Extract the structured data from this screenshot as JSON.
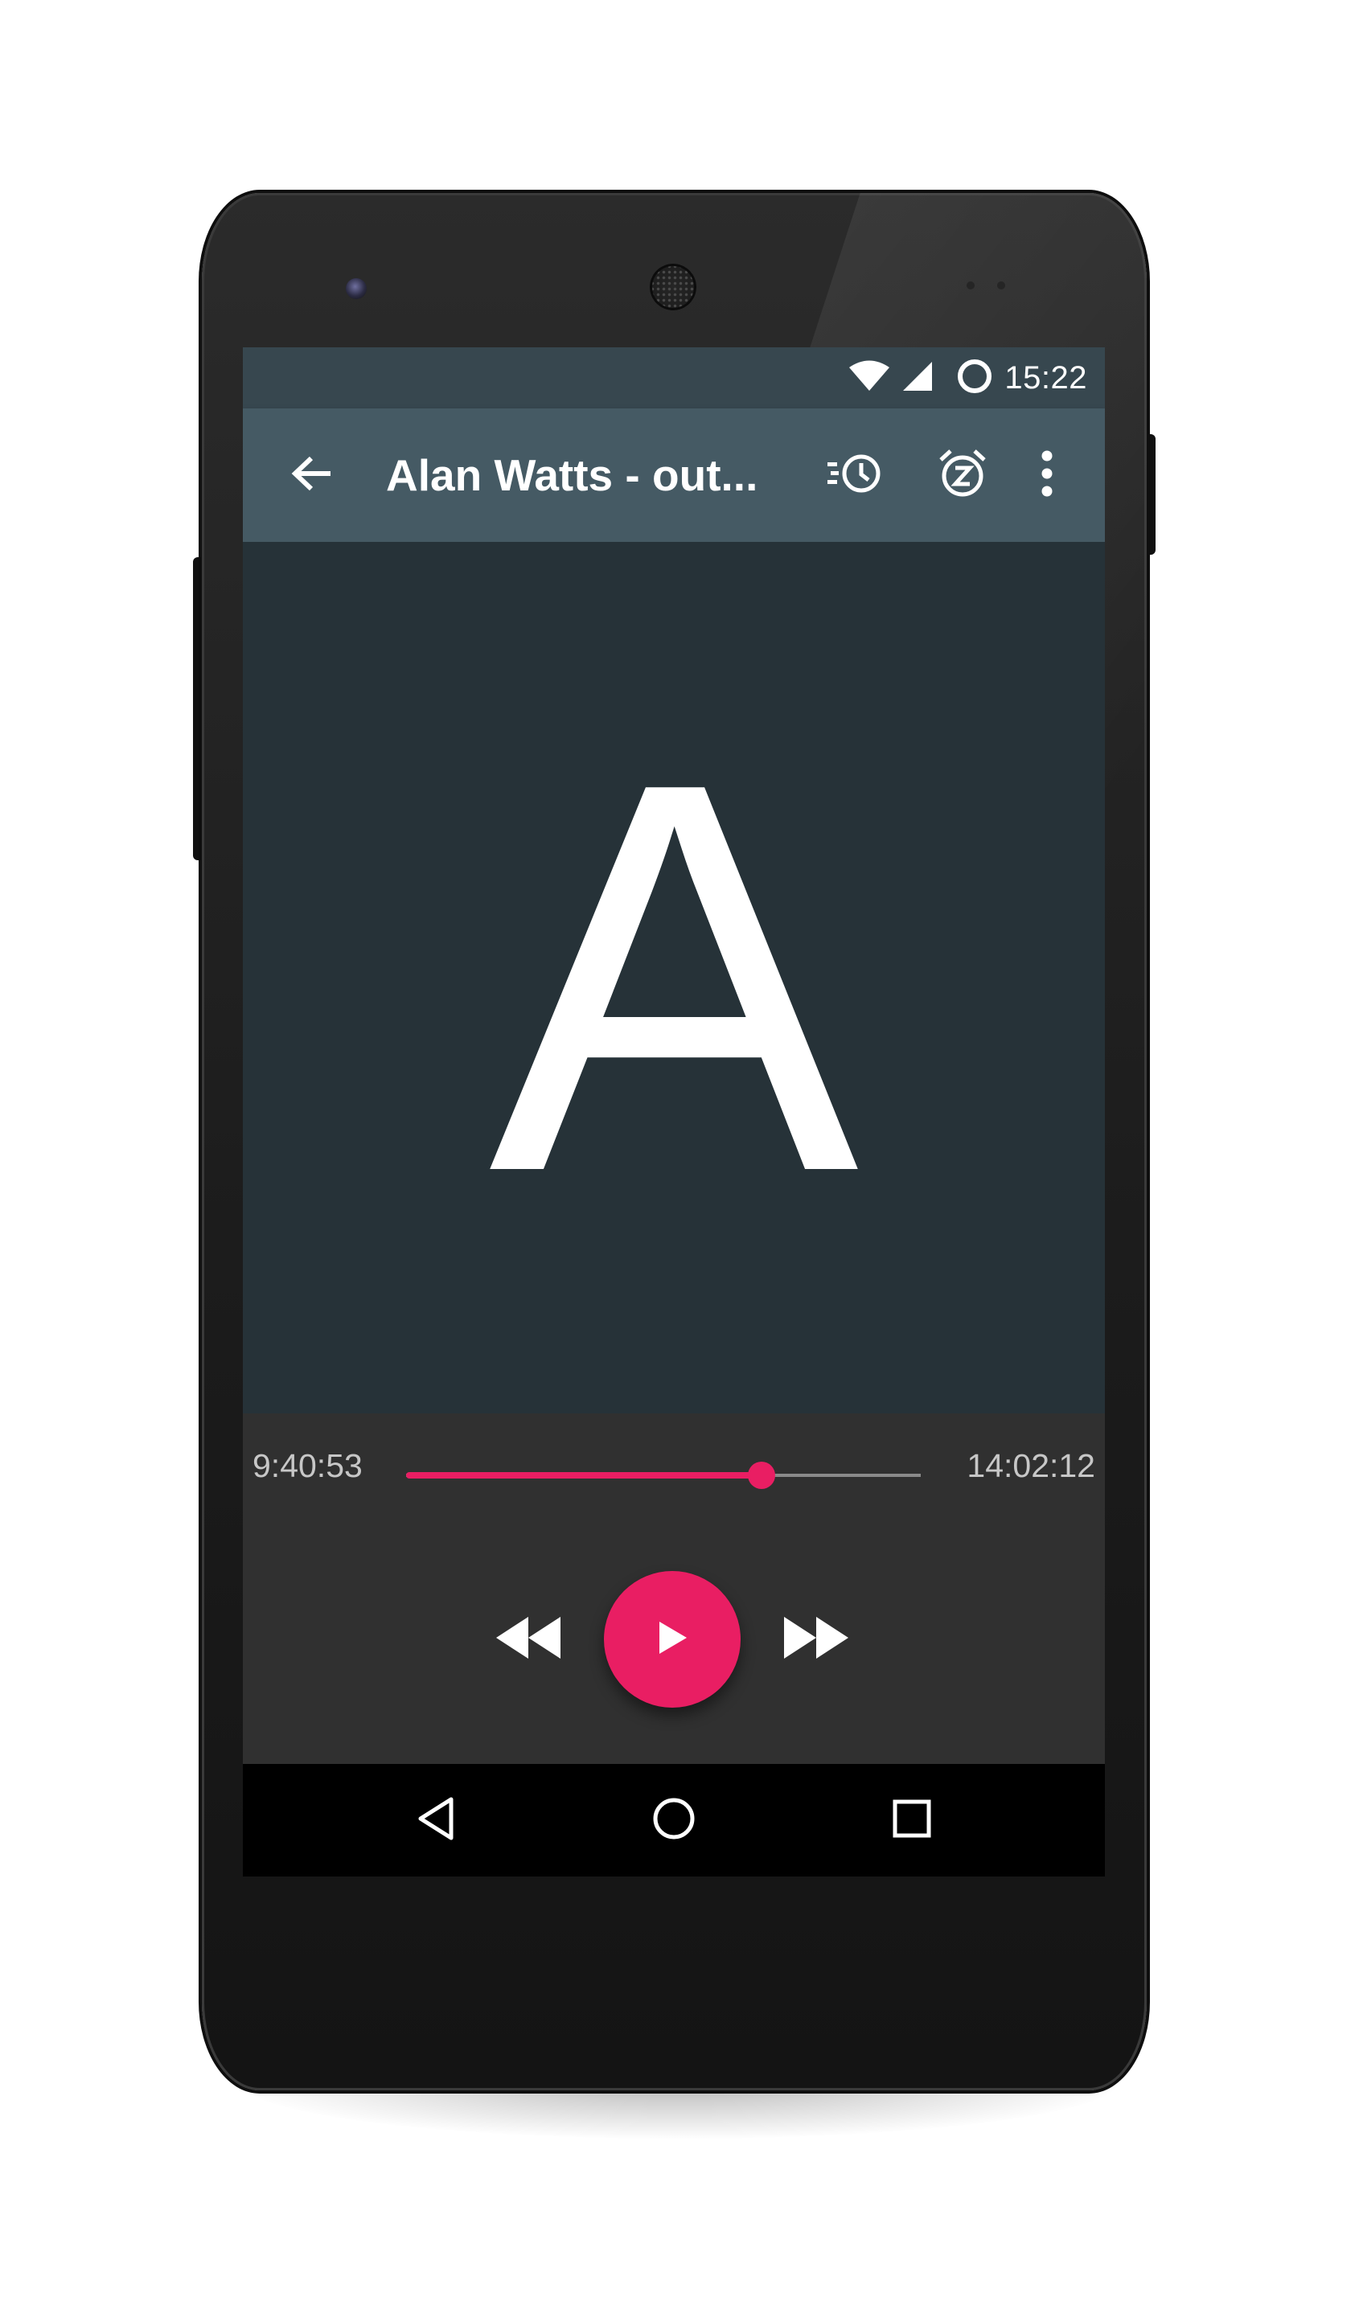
{
  "status_bar": {
    "time": "15:22",
    "icons": [
      "wifi-icon",
      "cell-signal-icon",
      "circle-status-icon"
    ]
  },
  "toolbar": {
    "back_icon": "arrow-back-icon",
    "title": "Alan Watts - out...",
    "actions": [
      "playback-speed-icon",
      "sleep-timer-icon",
      "more-vert-icon"
    ]
  },
  "cover": {
    "letter": "A"
  },
  "player": {
    "elapsed": "9:40:53",
    "total": "14:02:12",
    "progress": 0.69,
    "accent_color": "#e91e63",
    "controls": [
      "rewind-icon",
      "play-icon",
      "fast-forward-icon"
    ]
  },
  "navbar": {
    "icons": [
      "nav-back-icon",
      "nav-home-icon",
      "nav-recents-icon"
    ]
  }
}
